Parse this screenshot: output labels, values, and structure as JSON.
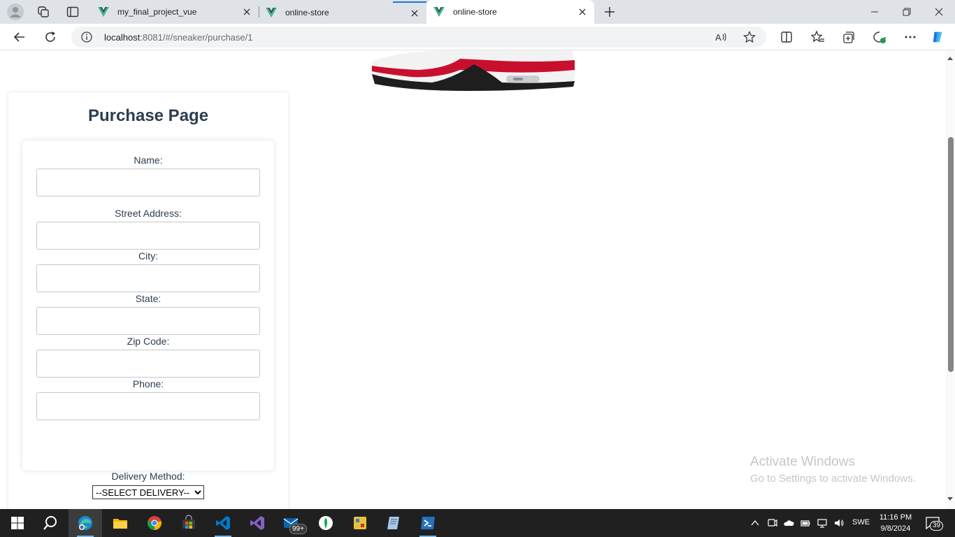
{
  "browser": {
    "tabs": [
      {
        "title": "my_final_project_vue",
        "active": false
      },
      {
        "title": "online-store",
        "active": false
      },
      {
        "title": "online-store",
        "active": true
      }
    ],
    "address": {
      "host": "localhost",
      "rest": ":8081/#/sneaker/purchase/1"
    }
  },
  "page": {
    "title": "Purchase Page",
    "fields": [
      {
        "label": "Name:",
        "value": ""
      },
      {
        "label": "Street Address:",
        "value": ""
      },
      {
        "label": "City:",
        "value": ""
      },
      {
        "label": "State:",
        "value": ""
      },
      {
        "label": "Zip Code:",
        "value": ""
      },
      {
        "label": "Phone:",
        "value": ""
      }
    ],
    "delivery": {
      "label": "Delivery Method:",
      "selected": "--SELECT DELIVERY--"
    }
  },
  "watermark": {
    "line1": "Activate Windows",
    "line2": "Go to Settings to activate Windows."
  },
  "taskbar": {
    "mail_badge": "99+",
    "language": "SWE",
    "time": "11:16 PM",
    "date": "9/8/2024",
    "notifications": "39"
  },
  "colors": {
    "title": "#2c3e50",
    "vue_green": "#42b883",
    "vue_dark": "#35495e",
    "accent": "#1a73e8"
  }
}
